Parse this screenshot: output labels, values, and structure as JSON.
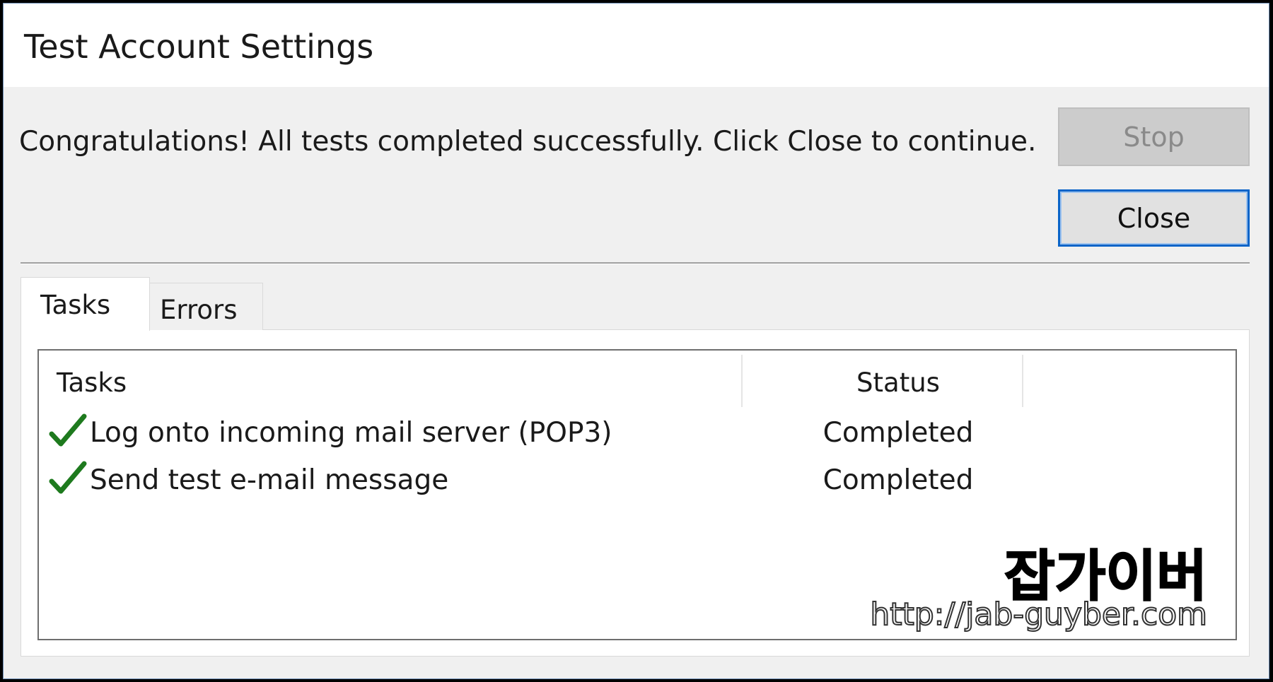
{
  "window": {
    "title": "Test Account Settings"
  },
  "message": "Congratulations! All tests completed successfully. Click Close to continue.",
  "buttons": {
    "stop_label": "Stop",
    "close_label": "Close"
  },
  "tabs": [
    {
      "label": "Tasks",
      "selected": true
    },
    {
      "label": "Errors",
      "selected": false
    }
  ],
  "task_list": {
    "columns": [
      "Tasks",
      "Status"
    ],
    "rows": [
      {
        "icon": "check-icon",
        "task": "Log onto incoming mail server (POP3)",
        "status": "Completed"
      },
      {
        "icon": "check-icon",
        "task": "Send test e-mail message",
        "status": "Completed"
      }
    ]
  },
  "watermark": {
    "korean": "잡가이버",
    "url": "http://jab-guyber.com"
  },
  "colors": {
    "check": "#1e7a1e",
    "close_button_border": "#0a64c8",
    "dialog_background": "#f0f0f0"
  }
}
